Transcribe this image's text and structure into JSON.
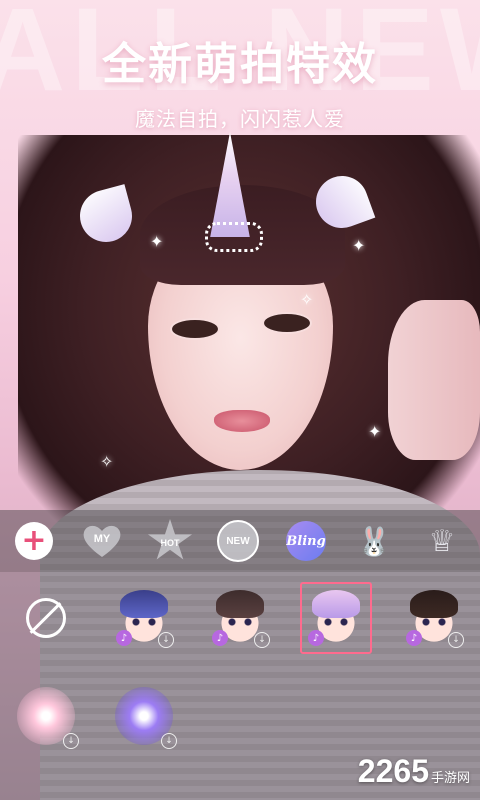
{
  "hero": {
    "background_word": "ALL NEW",
    "title": "全新萌拍特效",
    "subtitle": "魔法自拍，闪闪惹人爱"
  },
  "effect_tabs": [
    {
      "name": "add",
      "label": "+",
      "icon": "plus-icon"
    },
    {
      "name": "my",
      "label": "MY",
      "icon": "heart-icon"
    },
    {
      "name": "hot",
      "label": "HOT",
      "icon": "star-icon"
    },
    {
      "name": "new",
      "label": "NEW",
      "icon": "circle-icon"
    },
    {
      "name": "bling",
      "label": "Bling",
      "icon": "bling-icon",
      "selected": true
    },
    {
      "name": "rabbit",
      "label": "",
      "icon": "rabbit-icon"
    },
    {
      "name": "crown",
      "label": "",
      "icon": "crown-icon"
    }
  ],
  "effects": [
    {
      "name": "no-effect",
      "icon": "no-effect-icon"
    },
    {
      "name": "blue-fairy",
      "icon": "avatar-icon",
      "has_music": true,
      "downloadable": true
    },
    {
      "name": "pearl-princess",
      "icon": "avatar-icon",
      "has_music": true,
      "downloadable": true
    },
    {
      "name": "unicorn",
      "icon": "avatar-icon",
      "has_music": true,
      "selected": true
    },
    {
      "name": "devil-horns",
      "icon": "avatar-icon",
      "has_music": true,
      "downloadable": true
    },
    {
      "name": "pink-sparkle",
      "icon": "sparkle-icon",
      "downloadable": true
    },
    {
      "name": "purple-sparkle",
      "icon": "sparkle-icon",
      "downloadable": true
    }
  ],
  "watermark": {
    "brand": "2265",
    "site": "手游网"
  },
  "colors": {
    "accent": "#ff6b8e",
    "music_badge": "#b768e0",
    "bling": "#8b84f0"
  }
}
